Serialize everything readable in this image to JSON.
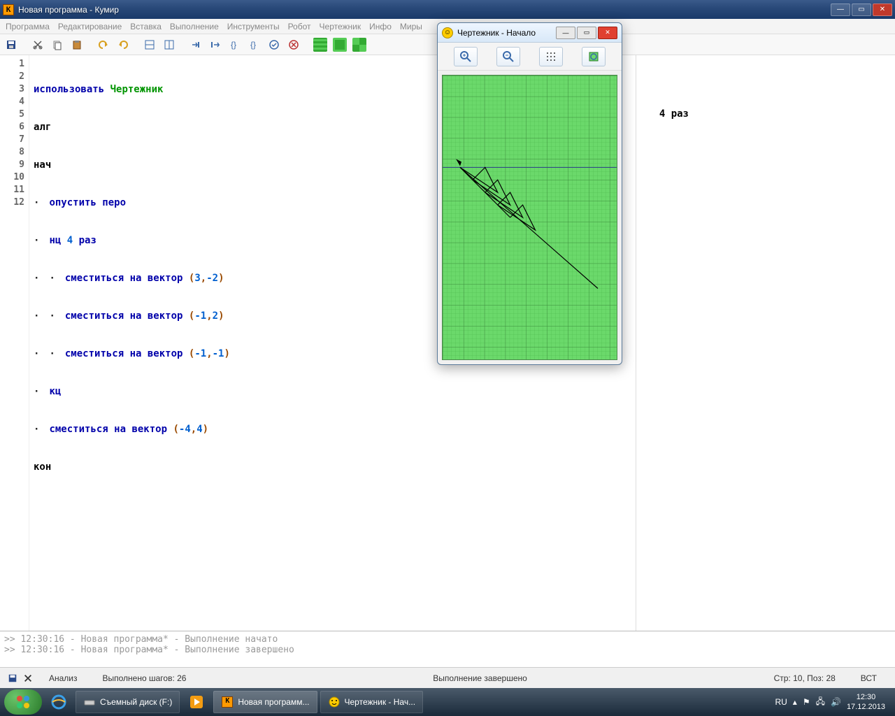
{
  "window": {
    "title": "Новая программа - Кумир"
  },
  "menu": {
    "program": "Программа",
    "edit": "Редактирование",
    "insert": "Вставка",
    "run": "Выполнение",
    "tools": "Инструменты",
    "robot": "Робот",
    "drafter": "Чертежник",
    "info": "Инфо",
    "worlds": "Миры"
  },
  "code": {
    "lines": [
      "1",
      "2",
      "3",
      "4",
      "5",
      "6",
      "7",
      "8",
      "9",
      "10",
      "11",
      "12"
    ],
    "l1": {
      "use": "использовать",
      "actor": "Чертежник"
    },
    "l2": {
      "alg": "алг"
    },
    "l3": {
      "begin": "нач"
    },
    "l4": {
      "pen": "опустить перо"
    },
    "l5": {
      "loop": "нц",
      "n": "4",
      "times": "раз"
    },
    "l6": {
      "move": "сместиться на вектор",
      "a": "3",
      "b": "-2"
    },
    "l7": {
      "move": "сместиться на вектор",
      "a": "-1",
      "b": "2"
    },
    "l8": {
      "move": "сместиться на вектор",
      "a": "-1",
      "b": "-1"
    },
    "l9": {
      "endloop": "кц"
    },
    "l10": {
      "move": "сместиться на вектор",
      "a": "-4",
      "b": "4"
    },
    "l11": {
      "end": "кон"
    }
  },
  "right_pane": {
    "text": "4 раз"
  },
  "drafter": {
    "title": "Чертежник - Начало"
  },
  "console": {
    "l1": ">> 12:30:16 - Новая программа* - Выполнение начато",
    "l2": ">> 12:30:16 - Новая программа* - Выполнение завершено"
  },
  "status": {
    "analysis": "Анализ",
    "steps": "Выполнено шагов: 26",
    "done": "Выполнение завершено",
    "cursor": "Стр: 10, Поз: 28",
    "mode": "ВСТ"
  },
  "taskbar": {
    "drive": "Съемный диск (F:)",
    "kumir": "Новая программ...",
    "drafter": "Чертежник - Нач...",
    "lang": "RU",
    "time": "12:30",
    "date": "17.12.2013"
  }
}
